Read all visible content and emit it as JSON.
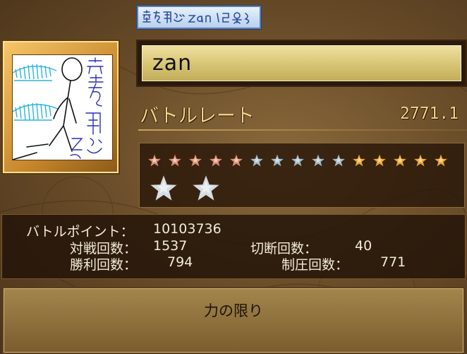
{
  "player": {
    "name": "zan",
    "name_tag": "空を飛ぶzan",
    "avatar_alt": "hand-drawn avatar"
  },
  "battle_rate": {
    "label": "バトルレート",
    "value": "2771.1"
  },
  "rank_stars": {
    "small": [
      "copper",
      "copper",
      "copper",
      "copper",
      "copper",
      "silver",
      "silver",
      "silver",
      "silver",
      "silver",
      "gold",
      "gold",
      "gold",
      "gold",
      "gold"
    ],
    "big": [
      "silver",
      "silver"
    ]
  },
  "stats": {
    "battle_points_label": "バトルポイント：",
    "battle_points_value": "10103736",
    "matches_label": "対戦回数：",
    "matches_value": "1537",
    "disconnects_label": "切断回数：",
    "disconnects_value": "40",
    "wins_label": "勝利回数：",
    "wins_value": "794",
    "conquests_label": "制圧回数：",
    "conquests_value": "771"
  },
  "title": {
    "text": "力の限り"
  },
  "colors": {
    "copper": "#d98b6e",
    "silver": "#9fb7c2",
    "gold": "#e8a32a"
  }
}
